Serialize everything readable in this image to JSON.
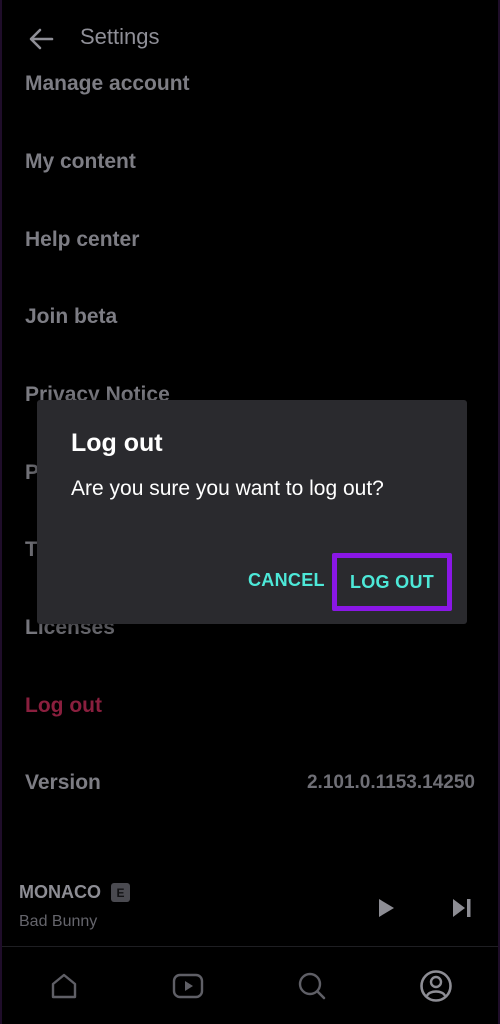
{
  "header": {
    "title": "Settings"
  },
  "settings_items": [
    {
      "label": "Manage account"
    },
    {
      "label": "My content"
    },
    {
      "label": "Help center"
    },
    {
      "label": "Join beta"
    },
    {
      "label": "Privacy Notice"
    },
    {
      "label": "P"
    },
    {
      "label": "T"
    },
    {
      "label": "Licenses"
    },
    {
      "label": "Log out"
    }
  ],
  "version": {
    "label": "Version",
    "value": "2.101.0.1153.14250"
  },
  "now_playing": {
    "title": "MONACO",
    "explicit_badge": "E",
    "artist": "Bad Bunny"
  },
  "bottom_nav": [
    {
      "icon": "home-icon"
    },
    {
      "icon": "video-play-icon"
    },
    {
      "icon": "search-icon"
    },
    {
      "icon": "profile-icon"
    }
  ],
  "dialog": {
    "title": "Log out",
    "message": "Are you sure you want to log out?",
    "cancel_label": "CANCEL",
    "confirm_label": "LOG OUT"
  },
  "colors": {
    "accent_teal": "#4de8d8",
    "highlight_purple": "#8a17e6",
    "danger_text": "#8a1f3e",
    "dialog_bg": "#2a2a2e"
  }
}
